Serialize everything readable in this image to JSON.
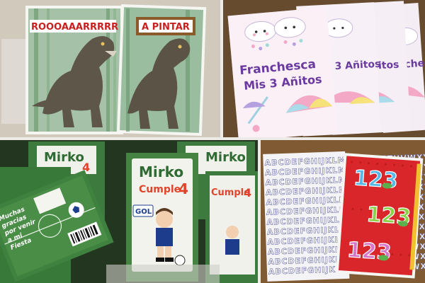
{
  "photos": {
    "dino": {
      "book1_banner": "ROOOAAARRRRR",
      "book2_banner": "A PINTAR"
    },
    "unicorn_cloud": {
      "name": "Franchesca",
      "subtitle": "Mis 3 Añitos"
    },
    "football": {
      "name": "Mirko",
      "event": "Cumple",
      "age": "4",
      "jersey_text": "GOL",
      "chocolate_message": [
        "Muchas",
        "gracias",
        "por venir",
        "a mi",
        "Fiesta"
      ]
    },
    "numbers": {
      "big_numbers": "123",
      "alphabet_sheet": "ABCDEFGHIJKLMNOPQRSTUVWXYZ"
    }
  },
  "colors": {
    "dino_banner_red": "#c8201e",
    "unicorn_purple": "#6a3aa0",
    "football_green": "#2f6b32",
    "mirko_red": "#e0452b",
    "notebook_red": "#d9262b"
  }
}
